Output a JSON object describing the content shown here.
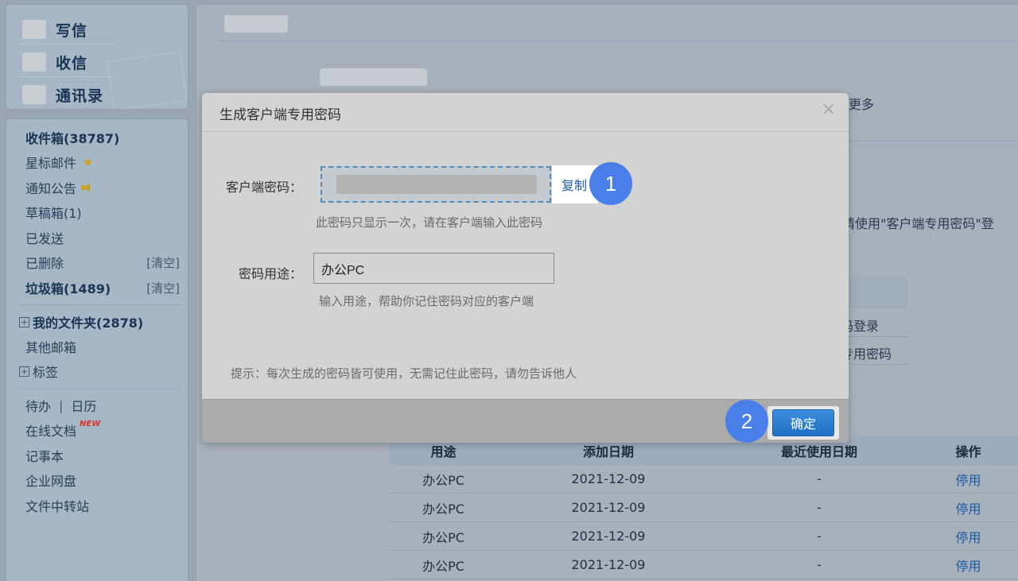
{
  "nav": {
    "compose": "写信",
    "receive": "收信",
    "contacts": "通讯录"
  },
  "folders": {
    "inbox": "收件箱(38787)",
    "starred": "星标邮件",
    "notice": "通知公告",
    "drafts": "草稿箱(1)",
    "sent": "已发送",
    "deleted": "已删除",
    "spam": "垃圾箱(1489)",
    "clear": "[清空]",
    "my_folders": "我的文件夹(2878)",
    "other_mail": "其他邮箱",
    "tags": "标签"
  },
  "apps": {
    "todo": "待办",
    "pipe": "|",
    "calendar": "日历",
    "online_docs": "在线文档",
    "new_badge": "NEW",
    "notes": "记事本",
    "disk": "企业网盘",
    "transfer": "文件中转站"
  },
  "background": {
    "more_fragment": "更多",
    "client_fragment": "端请使用\"客户端专用密码\"登",
    "login_fragment": "码登录",
    "special_pwd_fragment": "专用密码"
  },
  "table": {
    "headers": [
      "用途",
      "添加日期",
      "最近使用日期",
      "操作"
    ],
    "rows": [
      {
        "purpose": "办公PC",
        "added": "2021-12-09",
        "last_used": "-",
        "action": "停用"
      },
      {
        "purpose": "办公PC",
        "added": "2021-12-09",
        "last_used": "-",
        "action": "停用"
      },
      {
        "purpose": "办公PC",
        "added": "2021-12-09",
        "last_used": "-",
        "action": "停用"
      },
      {
        "purpose": "办公PC",
        "added": "2021-12-09",
        "last_used": "-",
        "action": "停用"
      }
    ]
  },
  "dialog": {
    "title": "生成客户端专用密码",
    "close": "×",
    "password_label": "客户端密码：",
    "copy": "复制",
    "password_hint": "此密码只显示一次，请在客户端输入此密码",
    "purpose_label": "密码用途：",
    "purpose_value": "办公PC",
    "purpose_hint": "输入用途，帮助你记住密码对应的客户端",
    "tip": "提示：每次生成的密码皆可使用，无需记住此密码，请勿告诉他人",
    "confirm": "确定"
  },
  "annotations": {
    "step1": "1",
    "step2": "2"
  },
  "colors": {
    "accent": "#1f6fc3",
    "badge": "#4a7fea",
    "link": "#1c5aa3"
  }
}
